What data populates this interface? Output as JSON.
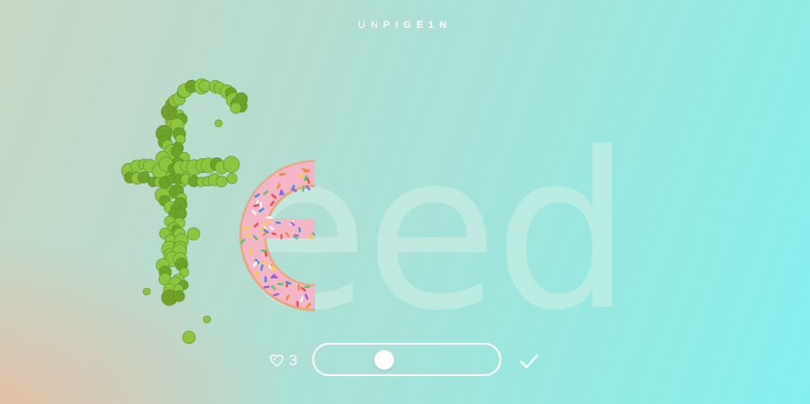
{
  "brand": {
    "thin_part": "UN",
    "bold_part": "PIGE1N"
  },
  "hero": {
    "word": "feed",
    "illustrated_letters": [
      "f",
      "e"
    ],
    "outline_letters": "eed",
    "colors": {
      "outline": "#d4f1e6",
      "peas": "#8fc43f",
      "pea_dark": "#6ea229",
      "donut_icing": "#f4b6c6",
      "donut_dough": "#e9a879"
    }
  },
  "controls": {
    "like_icon": "heart-icon",
    "like_count": "3",
    "slider_level": 0.38,
    "confirm_icon": "checkmark-icon"
  }
}
